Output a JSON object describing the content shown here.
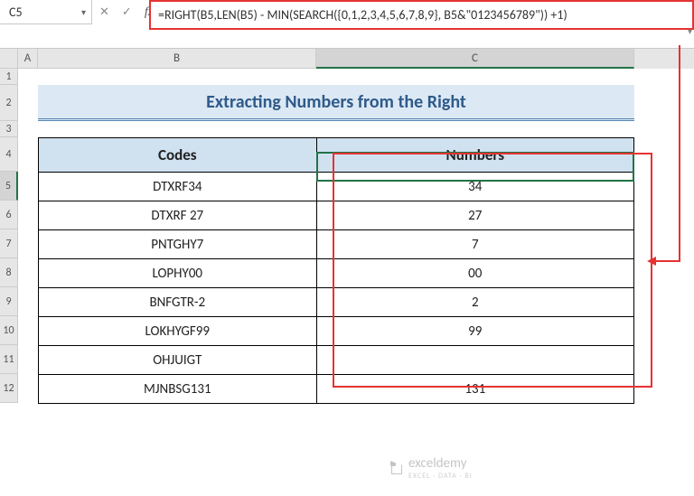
{
  "namebox": {
    "value": "C5"
  },
  "fb_icons": {
    "cancel": "✕",
    "confirm": "✓",
    "fx": "fx"
  },
  "formula": "=RIGHT(B5,LEN(B5) - MIN(SEARCH({0,1,2,3,4,5,6,7,8,9}, B5&\"0123456789\")) +1)",
  "columns": {
    "A": "A",
    "B": "B",
    "C": "C"
  },
  "page_title": "Extracting Numbers from the Right",
  "headers": {
    "codes": "Codes",
    "numbers": "Numbers"
  },
  "rows": [
    {
      "code": "DTXRF34",
      "num": "34"
    },
    {
      "code": "DTXRF 27",
      "num": "27"
    },
    {
      "code": "PNTGHY7",
      "num": "7"
    },
    {
      "code": "LOPHY00",
      "num": "00"
    },
    {
      "code": "BNFGTR-2",
      "num": "2"
    },
    {
      "code": "LOKHYGF99",
      "num": "99"
    },
    {
      "code": "OHJUIGT",
      "num": ""
    },
    {
      "code": "MJNBSG131",
      "num": "131"
    }
  ],
  "row_nums": [
    "1",
    "2",
    "3",
    "4",
    "5",
    "6",
    "7",
    "8",
    "9",
    "10",
    "11",
    "12"
  ],
  "watermark": {
    "brand": "exceldemy",
    "tag": "EXCEL · DATA · BI"
  }
}
